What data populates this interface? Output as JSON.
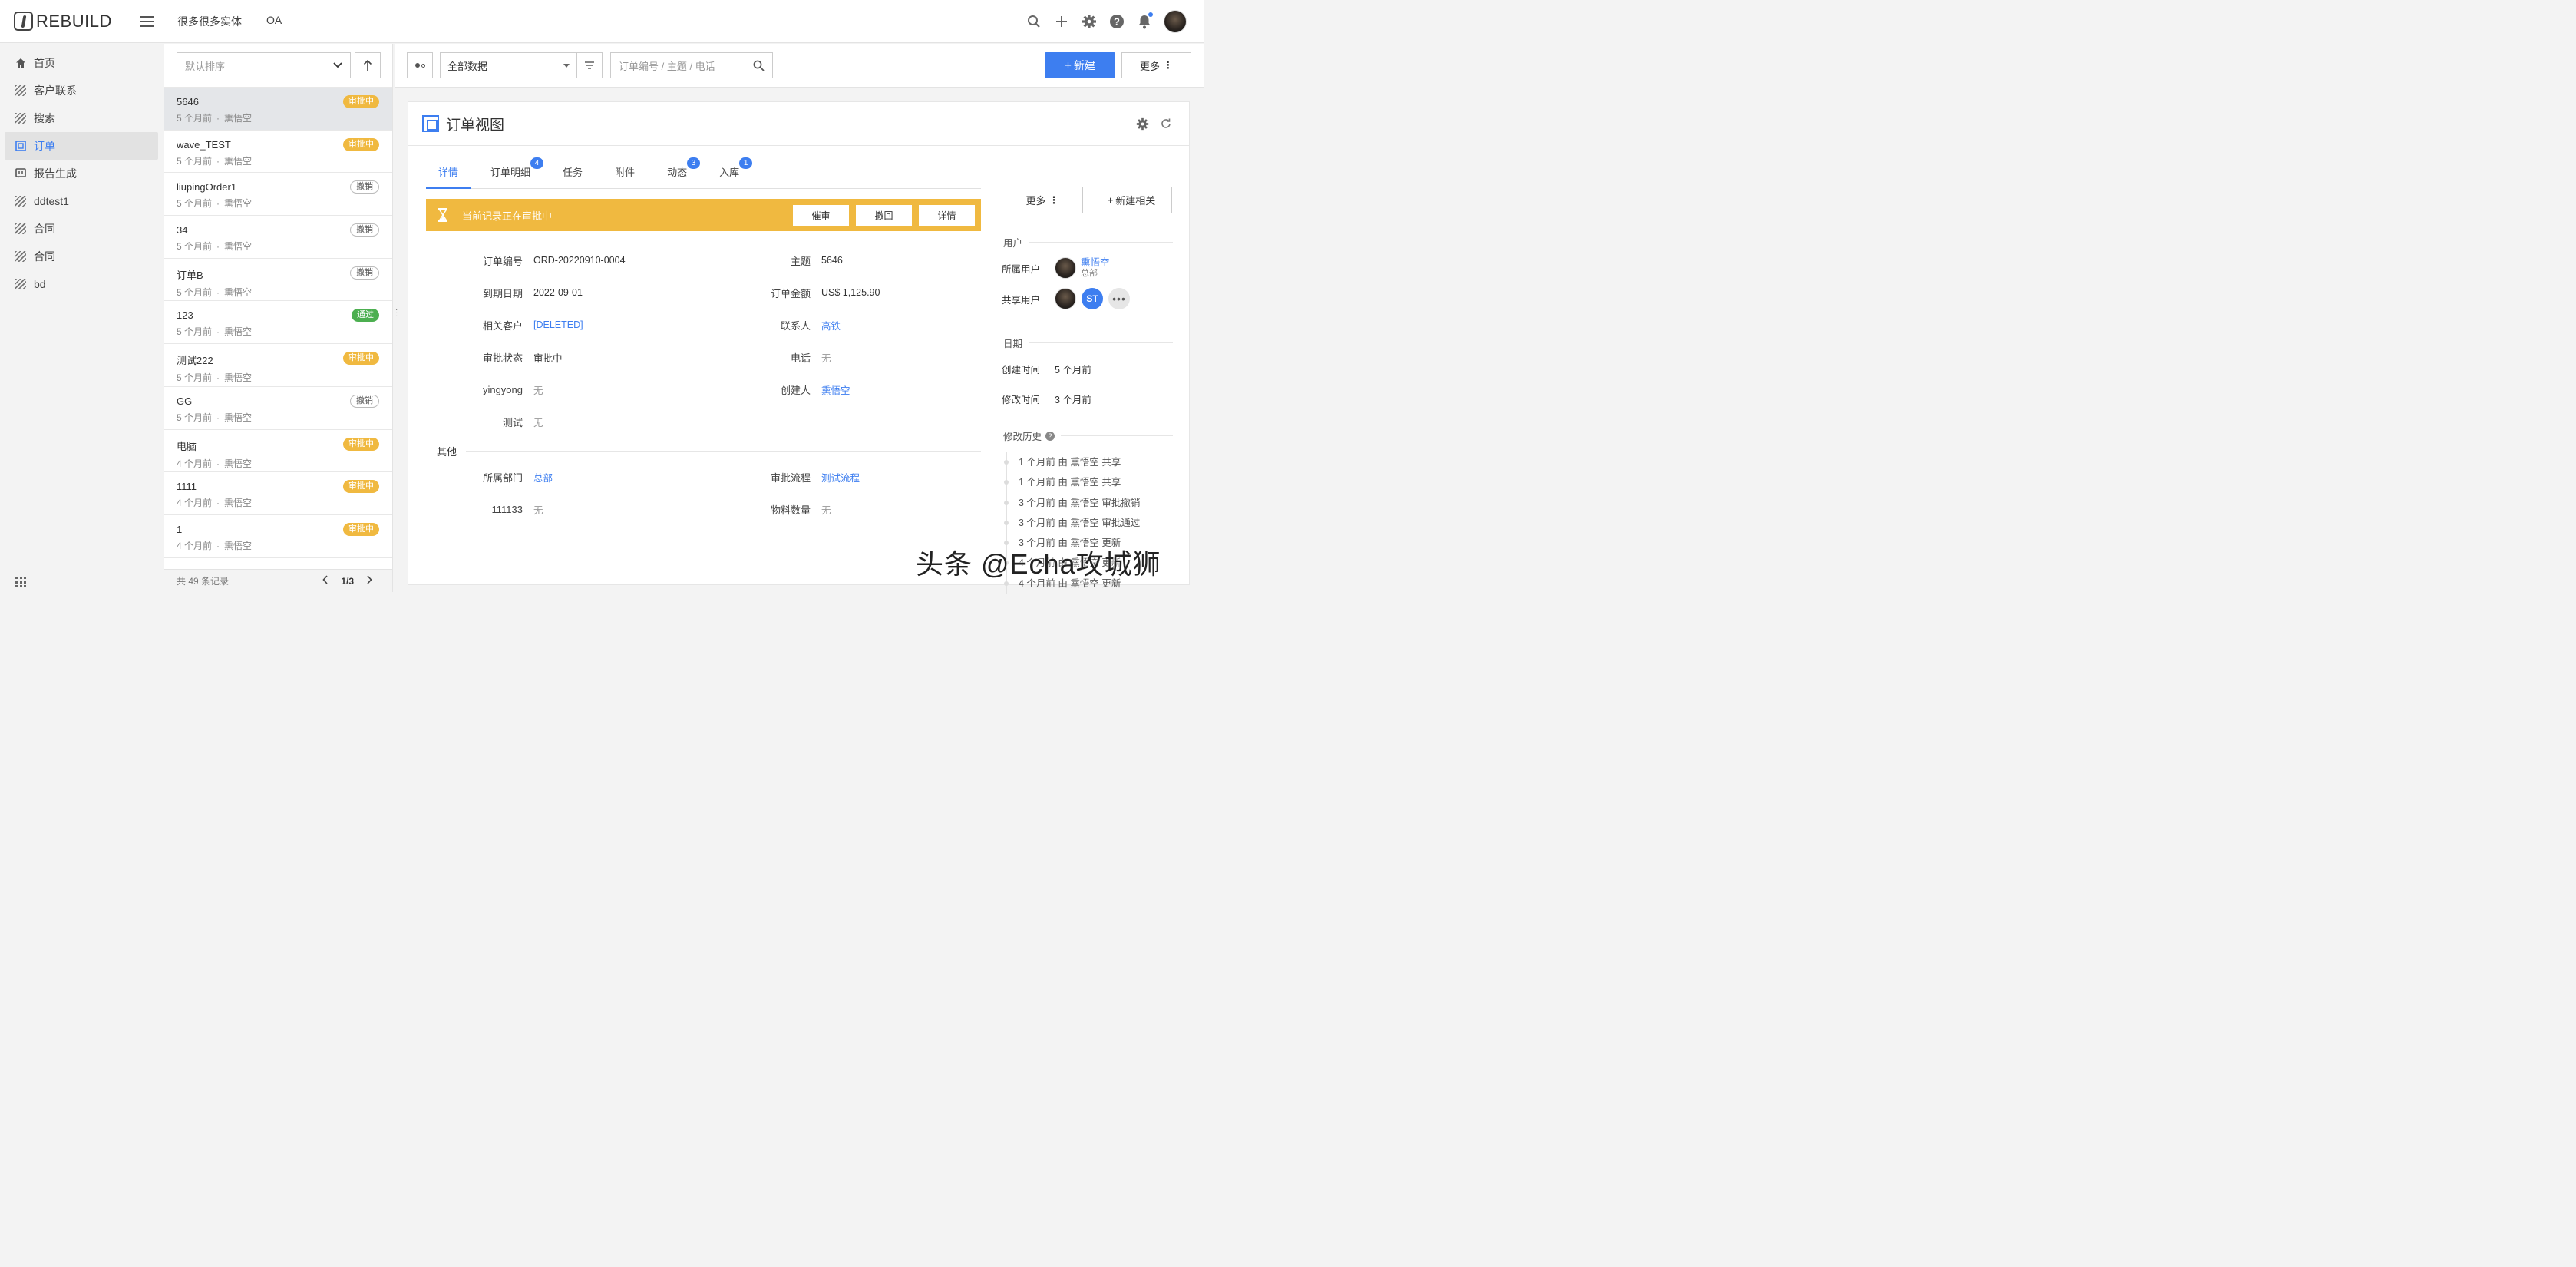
{
  "app": {
    "logo": "REBUILD"
  },
  "topnav": [
    "很多很多实体",
    "OA"
  ],
  "sidebar": {
    "items": [
      {
        "label": "首页",
        "icon": "home-icon"
      },
      {
        "label": "客户联系",
        "icon": "hatch-icon"
      },
      {
        "label": "搜索",
        "icon": "hatch-icon"
      },
      {
        "label": "订单",
        "icon": "order-icon",
        "active": true
      },
      {
        "label": "报告生成",
        "icon": "report-icon"
      },
      {
        "label": "ddtest1",
        "icon": "hatch-icon"
      },
      {
        "label": "合同",
        "icon": "hatch-icon"
      },
      {
        "label": "合同",
        "icon": "hatch-icon"
      },
      {
        "label": "bd",
        "icon": "hatch-icon"
      }
    ]
  },
  "list": {
    "sort_placeholder": "默认排序",
    "records": [
      {
        "title": "5646",
        "time": "5 个月前",
        "user": "熏悟空",
        "status": "审批中",
        "type": "warn"
      },
      {
        "title": "wave_TEST",
        "time": "5 个月前",
        "user": "熏悟空",
        "status": "审批中",
        "type": "warn"
      },
      {
        "title": "liupingOrder1",
        "time": "5 个月前",
        "user": "熏悟空",
        "status": "撤销",
        "type": "undo"
      },
      {
        "title": "34",
        "time": "5 个月前",
        "user": "熏悟空",
        "status": "撤销",
        "type": "undo"
      },
      {
        "title": "订单B",
        "time": "5 个月前",
        "user": "熏悟空",
        "status": "撤销",
        "type": "undo"
      },
      {
        "title": "123",
        "time": "5 个月前",
        "user": "熏悟空",
        "status": "通过",
        "type": "ok"
      },
      {
        "title": "测试222",
        "time": "5 个月前",
        "user": "熏悟空",
        "status": "审批中",
        "type": "warn"
      },
      {
        "title": "GG",
        "time": "5 个月前",
        "user": "熏悟空",
        "status": "撤销",
        "type": "undo"
      },
      {
        "title": "电脑",
        "time": "4 个月前",
        "user": "熏悟空",
        "status": "审批中",
        "type": "warn"
      },
      {
        "title": "1111",
        "time": "4 个月前",
        "user": "熏悟空",
        "status": "审批中",
        "type": "warn"
      },
      {
        "title": "1",
        "time": "4 个月前",
        "user": "熏悟空",
        "status": "审批中",
        "type": "warn"
      }
    ],
    "meta_separator": "·",
    "total": "共 49 条记录",
    "page": "1/3"
  },
  "toolbar": {
    "data_filter": "全部数据",
    "search_placeholder": "订单编号 / 主题 / 电话",
    "new_label": "新建",
    "more_label": "更多"
  },
  "view": {
    "title": "订单视图",
    "tabs": [
      {
        "label": "详情",
        "count": ""
      },
      {
        "label": "订单明细",
        "count": "4"
      },
      {
        "label": "任务",
        "count": ""
      },
      {
        "label": "附件",
        "count": ""
      },
      {
        "label": "动态",
        "count": "3"
      },
      {
        "label": "入库",
        "count": "1"
      }
    ],
    "approval": {
      "text": "当前记录正在审批中",
      "buttons": [
        "催审",
        "撤回",
        "详情"
      ]
    },
    "fields": {
      "order_no_label": "订单编号",
      "order_no": "ORD-20220910-0004",
      "subject_label": "主题",
      "subject": "5646",
      "due_label": "到期日期",
      "due": "2022-09-01",
      "amount_label": "订单金额",
      "amount": "US$ 1,125.90",
      "customer_label": "相关客户",
      "customer": "[DELETED]",
      "contact_label": "联系人",
      "contact": "高铁",
      "status_label": "审批状态",
      "status": "审批中",
      "phone_label": "电话",
      "phone": "无",
      "yingyong_label": "yingyong",
      "yingyong": "无",
      "creator_label": "创建人",
      "creator": "熏悟空",
      "test_label": "测试",
      "test": "无"
    },
    "other_section": "其他",
    "other": {
      "dept_label": "所属部门",
      "dept": "总部",
      "flow_label": "审批流程",
      "flow": "测试流程",
      "n111133_label": "111133",
      "n111133": "无",
      "qty_label": "物料数量",
      "qty": "无"
    }
  },
  "right": {
    "more_label": "更多",
    "new_related_label": "新建相关",
    "users_heading": "用户",
    "owner_label": "所属用户",
    "owner_name": "熏悟空",
    "owner_dept": "总部",
    "shared_label": "共享用户",
    "shared_initials": "ST",
    "date_heading": "日期",
    "created_label": "创建时间",
    "created": "5 个月前",
    "modified_label": "修改时间",
    "modified": "3 个月前",
    "history_heading": "修改历史",
    "history": [
      "1 个月前 由 熏悟空 共享",
      "1 个月前 由 熏悟空 共享",
      "3 个月前 由 熏悟空 审批撤销",
      "3 个月前 由 熏悟空 审批通过",
      "3 个月前 由 熏悟空 更新",
      "4 个月前 由 熏悟空 更新",
      "4 个月前 由 熏悟空 更新"
    ]
  },
  "watermark": "头条 @Echa攻城狮",
  "colors": {
    "accent": "#3d7ef0",
    "warn": "#f0b940",
    "ok": "#4caf50"
  }
}
